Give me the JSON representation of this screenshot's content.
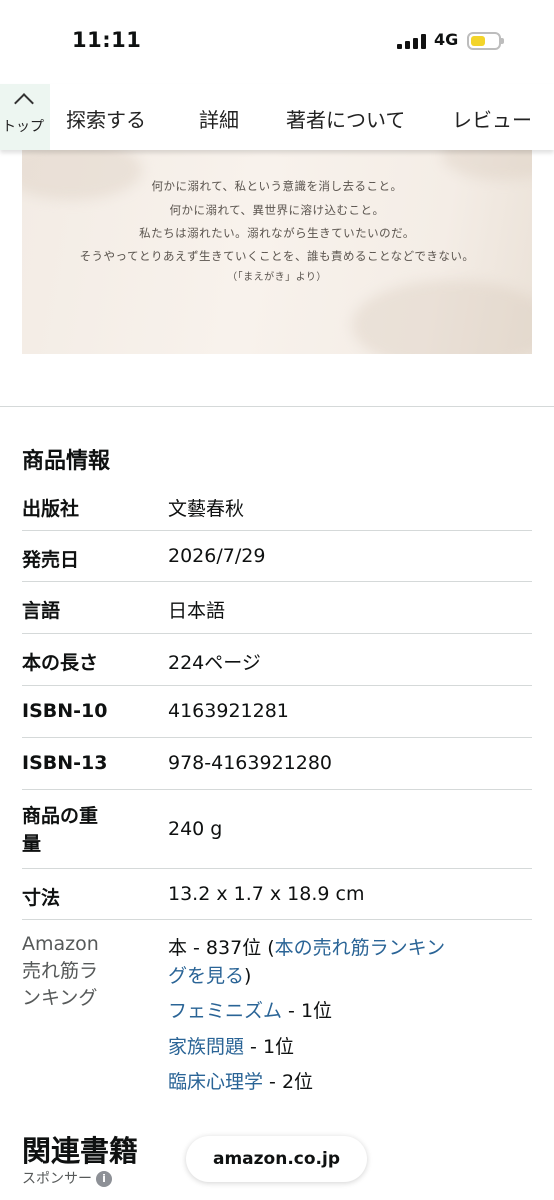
{
  "status_bar": {
    "time": "11:11",
    "network": "4G",
    "battery_level": 0.4,
    "battery_color": "#f3d42a"
  },
  "nav": {
    "top_label": "トップ",
    "tabs": [
      "探索する",
      "詳細",
      "著者について",
      "レビュー"
    ]
  },
  "banner": {
    "lines": [
      "何かに溺れて、私という意識を消し去ること。",
      "何かに溺れて、異世界に溶け込むこと。",
      "私たちは溺れたい。溺れながら生きていたいのだ。",
      "そうやってとりあえず生きていくことを、誰も責めることなどできない。"
    ],
    "source": "（「まえがき」より）"
  },
  "product_info": {
    "title": "商品情報",
    "rows": [
      {
        "key": "出版社",
        "value": "文藝春秋"
      },
      {
        "key": "発売日",
        "value": "2026/7/29"
      },
      {
        "key": "言語",
        "value": "日本語"
      },
      {
        "key": "本の長さ",
        "value": "224ページ"
      },
      {
        "key": "ISBN-10",
        "value": "4163921281"
      },
      {
        "key": "ISBN-13",
        "value": "978-4163921280"
      },
      {
        "key_line1": "商品の重",
        "key_line2": "量",
        "value": "240 g"
      },
      {
        "key": "寸法",
        "value": "13.2 x 1.7 x 18.9 cm"
      }
    ],
    "ranking": {
      "label_lines": [
        "Amazon",
        "売れ筋ラ",
        "ンキング"
      ],
      "overall_prefix": "本 - 837位 (",
      "overall_link_line1": "本の売れ筋ランキン",
      "overall_link_line2": "グを見る",
      "overall_suffix": ")",
      "categories": [
        {
          "name": "フェミニズム",
          "rank": " - 1位"
        },
        {
          "name": "家族問題",
          "rank": " - 1位"
        },
        {
          "name": "臨床心理学",
          "rank": " - 2位"
        }
      ]
    }
  },
  "related": {
    "title": "関連書籍",
    "sponsor": "スポンサー",
    "info_icon": "i"
  },
  "url_bar": {
    "domain": "amazon.co.jp"
  },
  "colors": {
    "link": "#2a6496",
    "divider": "#d5d9d9",
    "top_button_bg": "#edf6f1"
  }
}
